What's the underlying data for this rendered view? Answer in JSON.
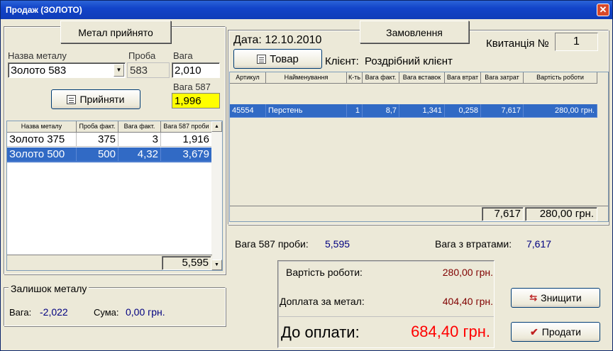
{
  "window": {
    "title": "Продаж (ЗОЛОТО)"
  },
  "left": {
    "metal_header": "Метал прийнято",
    "labels": {
      "name": "Назва металу",
      "probe": "Проба",
      "weight": "Вага",
      "weight587": "Вага 587"
    },
    "fields": {
      "name_value": "Золото 583",
      "probe_value": "583",
      "weight_value": "2,010",
      "weight587_value": "1,996"
    },
    "accept_button": "Прийняти",
    "table": {
      "columns": [
        "Назва металу",
        "Проба факт.",
        "Вага факт.",
        "Вага 587 проби"
      ],
      "rows": [
        [
          "Золото 375",
          "375",
          "3",
          "1,916"
        ],
        [
          "Золото 500",
          "500",
          "4,32",
          "3,679"
        ]
      ],
      "total": "5,595"
    },
    "remainder": {
      "header": "Залишок металу",
      "weight_label": "Вага:",
      "weight_value": "-2,022",
      "sum_label": "Сума:",
      "sum_value": "0,00 грн."
    }
  },
  "right": {
    "date_label": "Дата: 12.10.2010",
    "order_header": "Замовлення",
    "receipt_label": "Квитанція №",
    "receipt_number": "1",
    "goods_button": "Товар",
    "client_label": "Клієнт:",
    "client_value": "Роздрібний клієнт",
    "table": {
      "columns": [
        "Артикул",
        "Найменування",
        "К-ть",
        "Вага факт.",
        "Вага вставок",
        "Вага втрат",
        "Вага затрат",
        "Вартість роботи"
      ],
      "rows": [
        [
          "45554",
          "Перстень",
          "1",
          "8,7",
          "1,341",
          "0,258",
          "7,617",
          "280,00 грн."
        ]
      ],
      "totals": {
        "cost_weight": "7,617",
        "work_cost": "280,00 грн."
      }
    }
  },
  "summary": {
    "weight587_label": "Вага 587 проби:",
    "weight587_value": "5,595",
    "loss_label": "Вага з втратами:",
    "loss_value": "7,617",
    "work_label": "Вартість роботи:",
    "work_value": "280,00 грн.",
    "surcharge_label": "Доплата за метал:",
    "surcharge_value": "404,40 грн.",
    "total_label": "До оплати:",
    "total_value": "684,40 грн."
  },
  "actions": {
    "delete_button": "Знищити",
    "sell_button": "Продати"
  },
  "colors": {
    "selection": "#316ac5",
    "highlight_field": "#ffff00",
    "money_red": "#800000",
    "value_blue": "#000080",
    "total_red": "#ff0000"
  }
}
